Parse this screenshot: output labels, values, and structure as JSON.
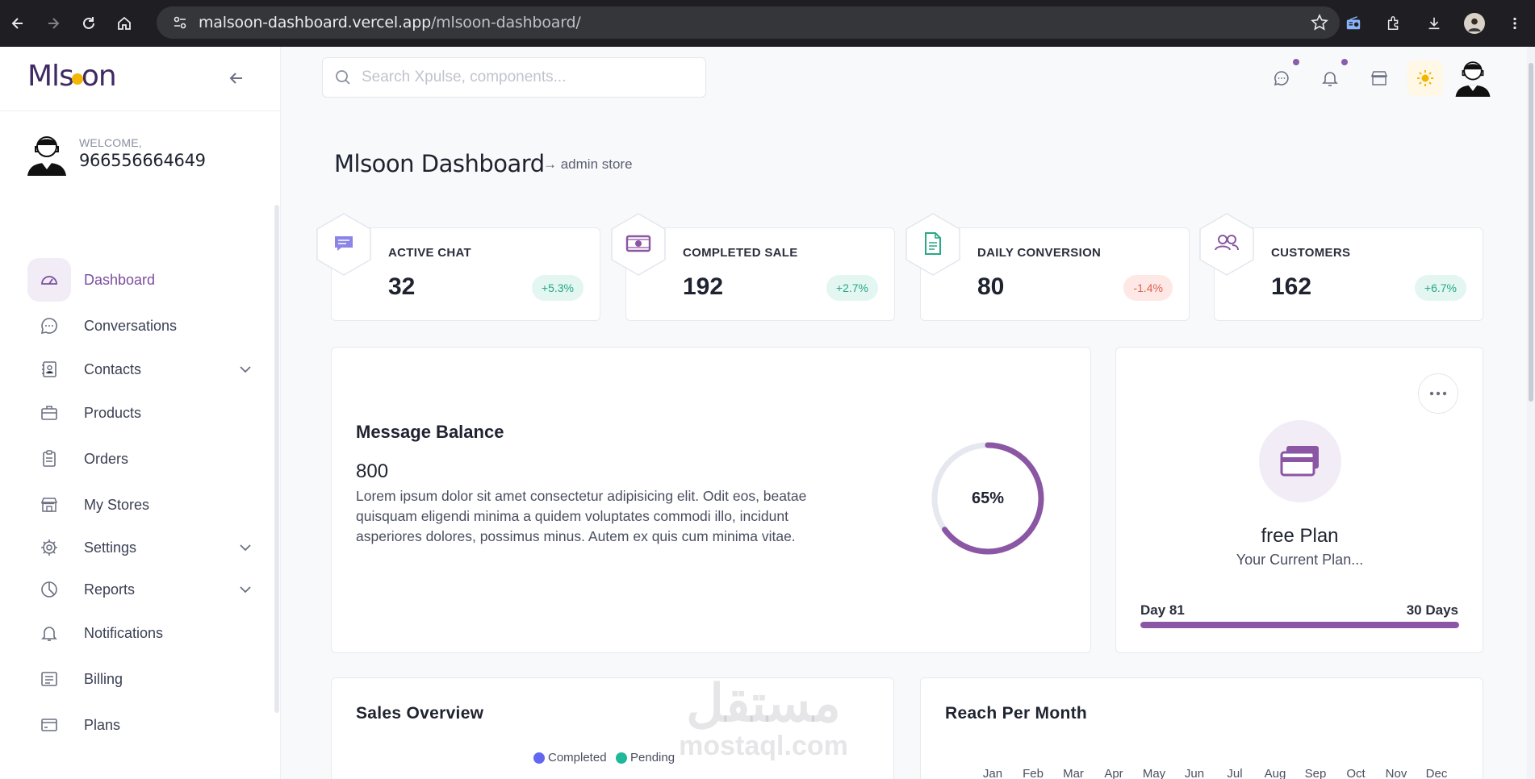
{
  "browser": {
    "url_host": "malsoon-dashboard.vercel.app",
    "url_path": "/mlsoon-dashboard/"
  },
  "brand": {
    "logo_prefix": "Mls",
    "logo_suffix": "on",
    "accent": "#7b4e9e",
    "logo_dot_color": "#f2b705"
  },
  "user": {
    "welcome": "WELCOME,",
    "name": "966556664649"
  },
  "sidebar": {
    "items": [
      {
        "label": "Dashboard",
        "icon": "dashboard-gauge-icon",
        "active": true
      },
      {
        "label": "Conversations",
        "icon": "chat-bubble-icon"
      },
      {
        "label": "Contacts",
        "icon": "contact-book-icon",
        "expandable": true
      },
      {
        "label": "Products",
        "icon": "briefcase-icon"
      },
      {
        "label": "Orders",
        "icon": "clipboard-icon"
      },
      {
        "label": "My Stores",
        "icon": "store-icon"
      },
      {
        "label": "Settings",
        "icon": "gear-icon",
        "expandable": true
      },
      {
        "label": "Reports",
        "icon": "pie-chart-icon",
        "expandable": true
      },
      {
        "label": "Notifications",
        "icon": "bell-icon"
      },
      {
        "label": "Billing",
        "icon": "billing-icon"
      },
      {
        "label": "Plans",
        "icon": "card-icon"
      }
    ]
  },
  "search": {
    "placeholder": "Search Xpulse, components..."
  },
  "header": {
    "title": "Mlsoon Dashboard",
    "subtitle": "→ admin store"
  },
  "stats": [
    {
      "title": "ACTIVE CHAT",
      "value": "32",
      "change": "+5.3%",
      "trend": "up",
      "icon": "message-icon",
      "icon_color": "#8b85e8"
    },
    {
      "title": "COMPLETED SALE",
      "value": "192",
      "change": "+2.7%",
      "trend": "up",
      "icon": "cash-icon",
      "icon_color": "#8b56a3"
    },
    {
      "title": "DAILY CONVERSION",
      "value": "80",
      "change": "-1.4%",
      "trend": "down",
      "icon": "document-icon",
      "icon_color": "#27a983"
    },
    {
      "title": "CUSTOMERS",
      "value": "162",
      "change": "+6.7%",
      "trend": "up",
      "icon": "users-icon",
      "icon_color": "#8b56a3"
    }
  ],
  "message_balance": {
    "title": "Message Balance",
    "value": "800",
    "description": "Lorem ipsum dolor sit amet consectetur adipisicing elit. Odit eos, beatae quisquam eligendi minima a quidem voluptates commodi illo, incidunt asperiores dolores, possimus minus. Autem ex quis cum minima vitae.",
    "percent": 65,
    "percent_label": "65%"
  },
  "plan": {
    "name": "free Plan",
    "subtitle": "Your Current Plan...",
    "day_label": "Day 81",
    "days_label": "30 Days",
    "progress": 1.0
  },
  "sales_overview": {
    "title": "Sales Overview",
    "legend": [
      {
        "label": "Completed",
        "color": "#6366f1"
      },
      {
        "label": "Pending",
        "color": "#1fb89a"
      }
    ]
  },
  "reach": {
    "title": "Reach Per Month",
    "months": [
      "Jan",
      "Feb",
      "Mar",
      "Apr",
      "May",
      "Jun",
      "Jul",
      "Aug",
      "Sep",
      "Oct",
      "Nov",
      "Dec"
    ]
  },
  "watermark": {
    "arabic": "مستقل",
    "latin": "mostaql.com"
  }
}
